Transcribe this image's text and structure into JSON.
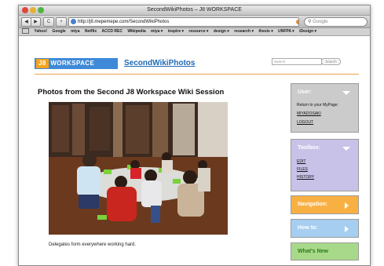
{
  "window": {
    "title": "SecondWikiPhotos – J8 WORKSPACE"
  },
  "toolbar": {
    "back_label": "◀",
    "forward_label": "▶",
    "reload_label": "C",
    "add_label": "+",
    "url": "http://j8.mepemepe.com/SecondWikiPhotos",
    "search_placeholder": "Google"
  },
  "bookmarks": [
    "Yahoo!",
    "Google",
    "miya",
    "Netflix",
    "ACCD REC",
    "Wikipedia",
    "miya ▾",
    "inspire ▾",
    "resource ▾",
    "design ▾",
    "research ▾",
    "thesis ▾",
    "UNFPA ▾",
    "iDesign ▾"
  ],
  "site": {
    "logo_j8": "J8",
    "logo_text": "WORKSPACE",
    "page_link": "SecondWikiPhotos",
    "search_placeholder": "Search",
    "search_button": "Search"
  },
  "main": {
    "title": "Photos from the Second J8 Workspace Wiki Session",
    "caption": "Delegates form everywhere working hard."
  },
  "sidebar": {
    "user": {
      "title": "User:",
      "return_text": "Return to your MyPage:",
      "username": "MIYADOSAKI",
      "logout": "LOGOUT"
    },
    "toolbox": {
      "title": "Toolbox:",
      "items": [
        "EDIT",
        "FILES",
        "HISTORY"
      ]
    },
    "navigation": {
      "title": "Navigation:"
    },
    "howto": {
      "title": "How to:"
    },
    "whatsnew": {
      "title": "What's New"
    }
  },
  "colors": {
    "accent_blue": "#3f8ad8",
    "accent_orange": "#f4a31c",
    "user_panel": "#cbcbcb",
    "toolbox_panel": "#c8c1e8",
    "nav_panel": "#f9b042",
    "howto_panel": "#a6cef0",
    "new_panel": "#a8d98b"
  },
  "icons": [
    "close-button",
    "minimize-button",
    "zoom-button",
    "globe-icon",
    "rss-icon",
    "search-icon",
    "bookmarks-icon",
    "chevron-down-icon",
    "chevron-right-icon"
  ]
}
